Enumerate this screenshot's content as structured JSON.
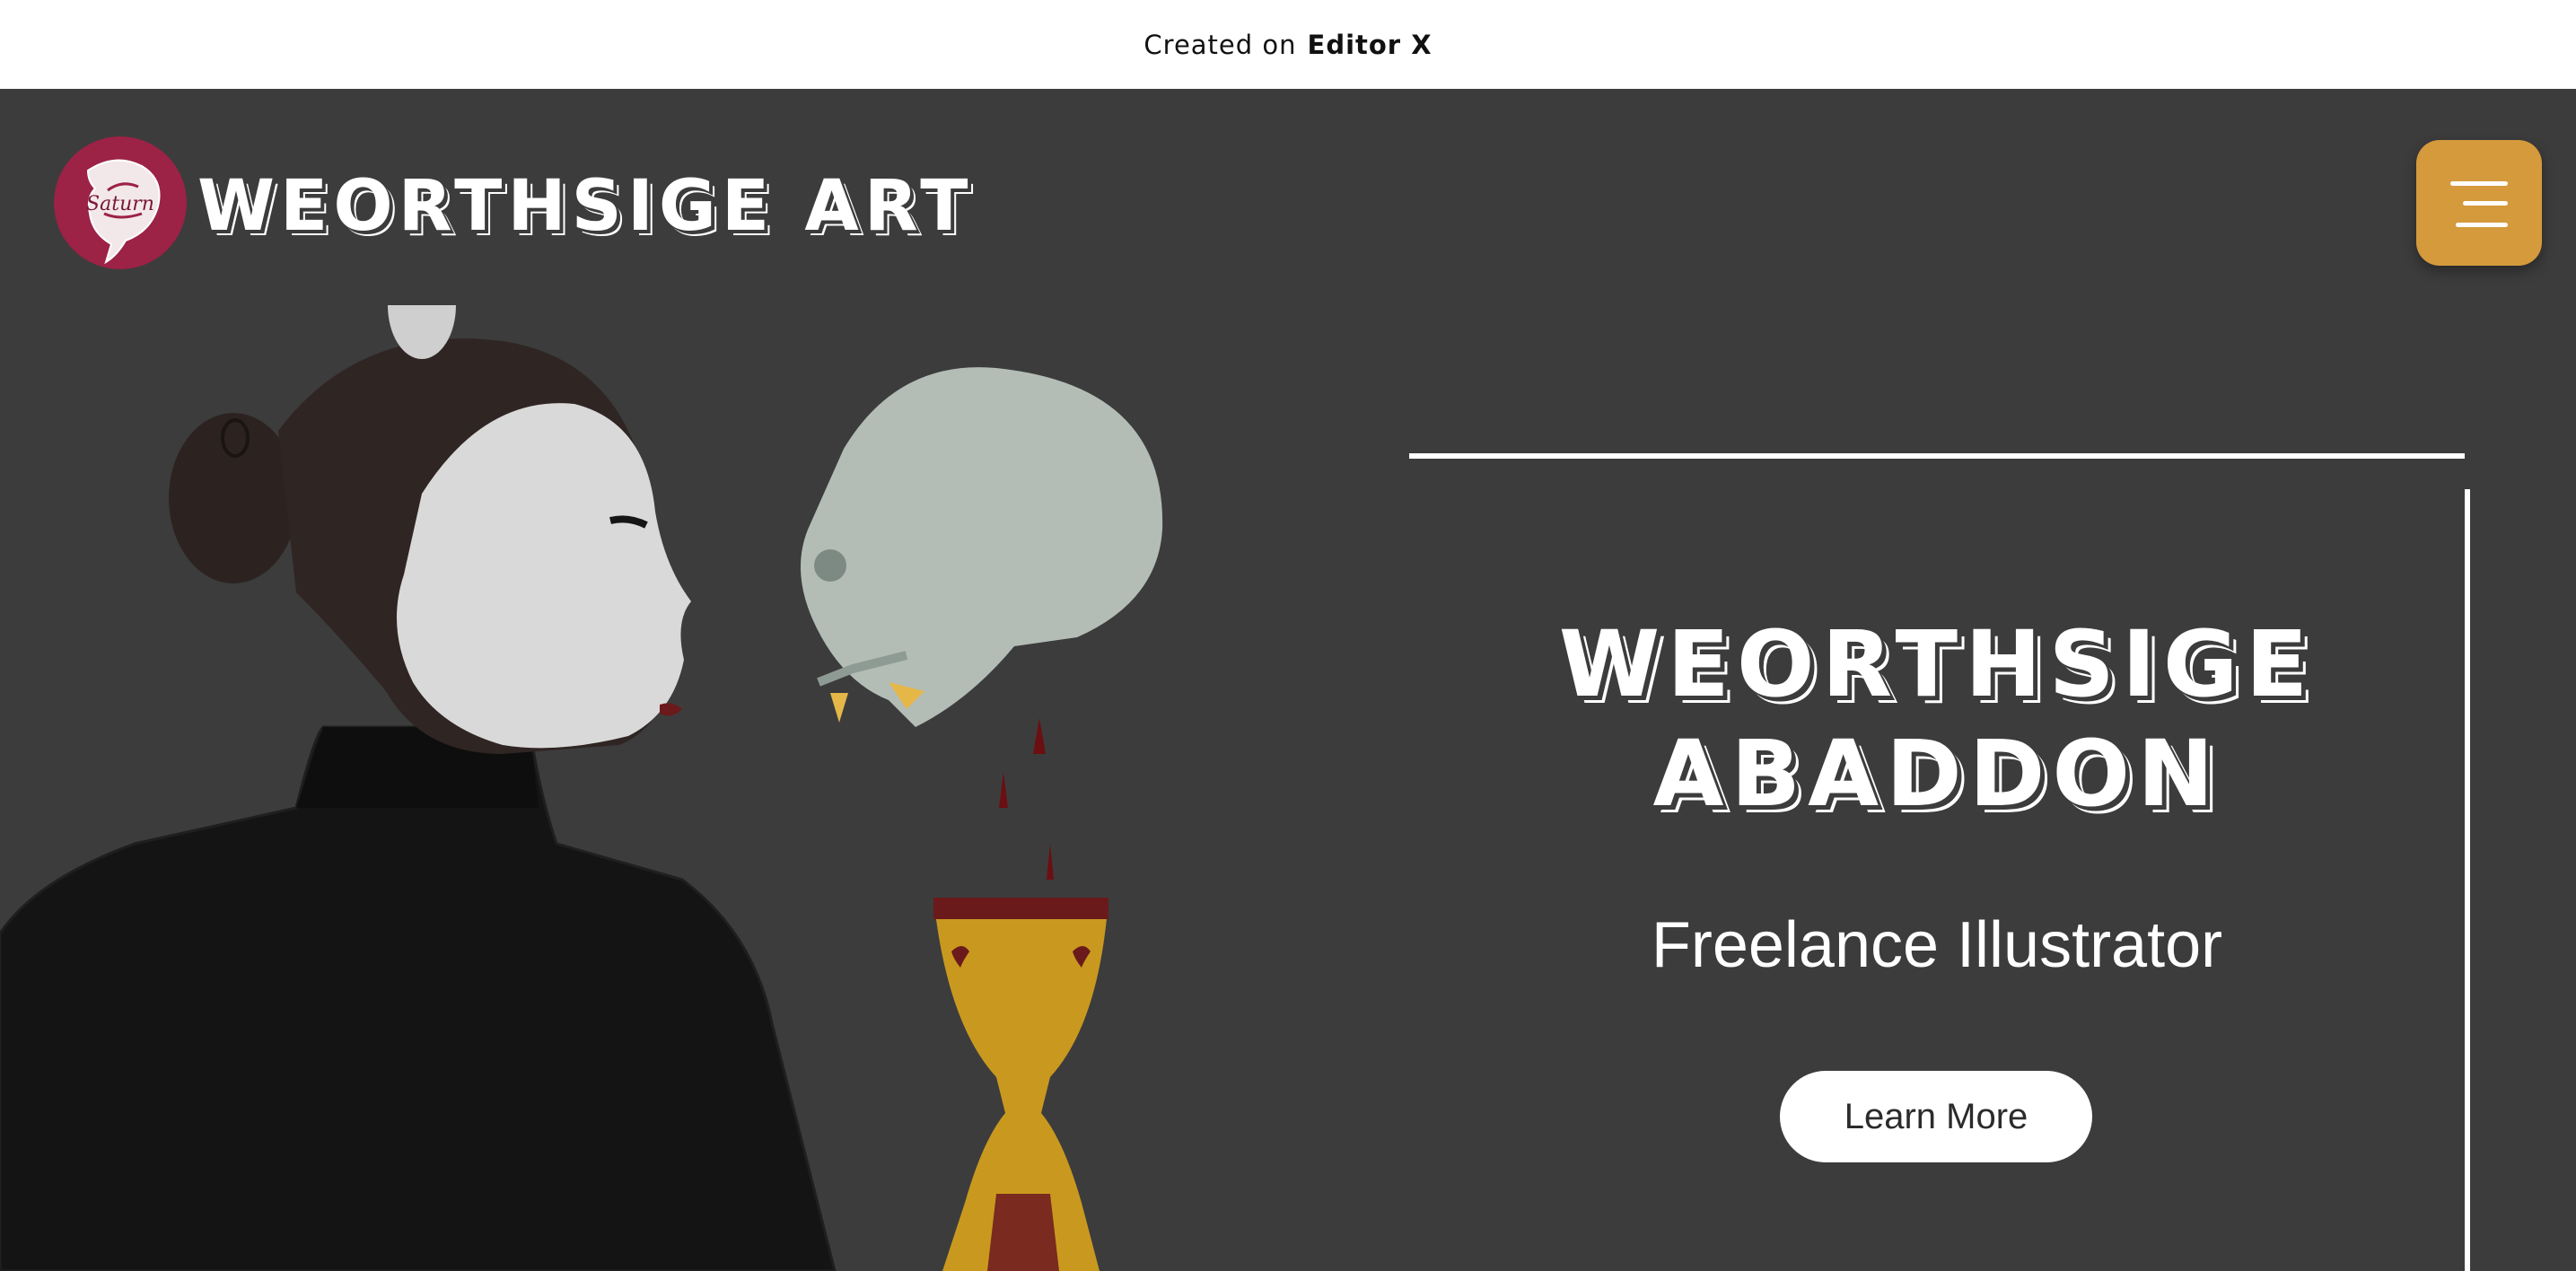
{
  "banner": {
    "prefix": "Created on",
    "brand": "Editor",
    "brand_mark": "X"
  },
  "header": {
    "site_title": "WEORTHSIGE ART",
    "logo_script": "Saturn"
  },
  "hero": {
    "headline_line1": "WEORTHSIGE",
    "headline_line2": "ABADDON",
    "subtitle": "Freelance Illustrator",
    "cta_label": "Learn More"
  },
  "colors": {
    "background": "#3c3c3d",
    "accent": "#d49a3c",
    "logo": "#9c2246",
    "text": "#ffffff"
  },
  "icons": {
    "menu": "hamburger-icon",
    "logo": "fox-logo-icon"
  }
}
